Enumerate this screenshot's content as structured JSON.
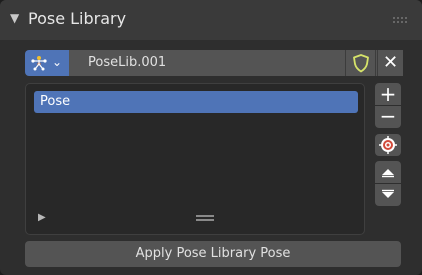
{
  "panel": {
    "title": "Pose Library",
    "collapse_icon": "triangle-down-icon",
    "grip_icon": "drag-grip-icon"
  },
  "datablock": {
    "type_icon": "pose-library-icon",
    "chevron_icon": "chevron-down-icon",
    "name": "PoseLib.001",
    "fake_user_icon": "shield-icon",
    "new_icon": "plus-icon",
    "unlink_icon": "close-icon",
    "accent_color": "#4f74b7"
  },
  "pose_list": {
    "items": [
      {
        "label": "Pose",
        "selected": true
      }
    ],
    "filter_icon": "triangle-right-icon",
    "resize_icon": "resize-handle-icon"
  },
  "side_buttons": {
    "add": "+",
    "remove": "−",
    "apply_icon": "target-icon",
    "move_up_icon": "triangle-up-icon",
    "move_down_icon": "triangle-down-icon"
  },
  "apply_button": {
    "label": "Apply Pose Library Pose"
  }
}
